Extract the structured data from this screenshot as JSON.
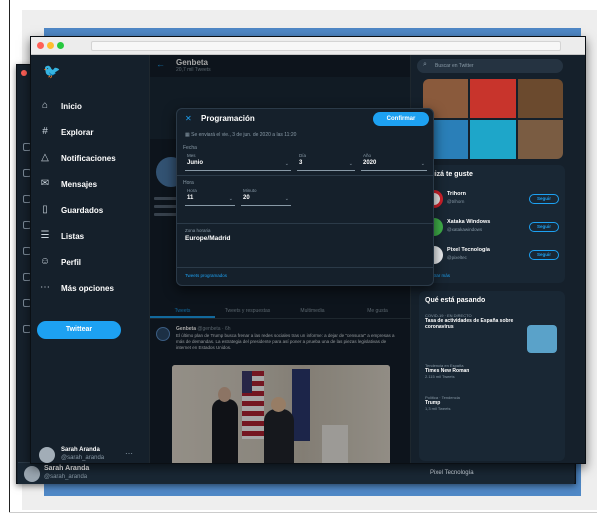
{
  "colors": {
    "accent": "#1da1f2",
    "background": "#15202b",
    "frame": "#4f88c6"
  },
  "sidebar": {
    "logo_icon": "twitter-bird-icon",
    "items": [
      {
        "label": "Inicio",
        "icon": "home-icon"
      },
      {
        "label": "Explorar",
        "icon": "hashtag-icon"
      },
      {
        "label": "Notificaciones",
        "icon": "bell-icon"
      },
      {
        "label": "Mensajes",
        "icon": "envelope-icon"
      },
      {
        "label": "Guardados",
        "icon": "bookmark-icon"
      },
      {
        "label": "Listas",
        "icon": "list-icon"
      },
      {
        "label": "Perfil",
        "icon": "person-icon"
      },
      {
        "label": "Más opciones",
        "icon": "more-icon"
      }
    ],
    "tweet_button": "Twittear",
    "account": {
      "name": "Sarah Aranda",
      "handle": "@sarah_aranda"
    }
  },
  "main": {
    "title": "Genbeta",
    "subtitle": "20,7 mil Tweets",
    "tabs": [
      "Tweets",
      "Tweets y respuestas",
      "Multimedia",
      "Me gusta"
    ],
    "tweet": {
      "author": "Genbeta",
      "meta": "@genbeta · 6h",
      "text": "El último plan de Trump busca frenar a las redes sociales tras un informe: a dejar de \"censurar\" a empresas a más de demandas. La estrategia del presidente para así poner a prueba una de las piezas legislativas de internet en Estados Unidos."
    }
  },
  "modal": {
    "title": "Programación",
    "confirm_button": "Confirmar",
    "scheduled_text": "Se enviará el vie., 3 de jun. de 2020 a las 11:20",
    "date_section": "Fecha",
    "month_label": "Mes",
    "month_value": "Junio",
    "day_label": "Día",
    "day_value": "3",
    "year_label": "Año",
    "year_value": "2020",
    "time_section": "Hora",
    "hour_label": "Hora",
    "hour_value": "11",
    "minute_label": "Minuto",
    "minute_value": "20",
    "zone_label": "Zona horaria",
    "zone_value": "Europe/Madrid",
    "footer_link": "Tweets programados"
  },
  "right": {
    "search_placeholder": "Buscar en Twitter",
    "follow_title": "Quizá te guste",
    "suggestions": [
      {
        "name": "Trihorn",
        "handle": "@trihorn",
        "button": "Seguir"
      },
      {
        "name": "Xataka Windows",
        "handle": "@xatakawindows",
        "button": "Seguir"
      },
      {
        "name": "Pixel Tecnología",
        "handle": "@pixeltec",
        "button": "Seguir"
      }
    ],
    "show_more": "Mostrar más",
    "trends_title": "Qué está pasando",
    "trends": [
      {
        "category": "COVID-19 · EN DIRECTO",
        "name": "Tasa de actividades de España sobre coronavirus",
        "count": ""
      },
      {
        "category": "Tendencia en España",
        "name": "Times New Roman",
        "count": "2.115 mil Tweets"
      },
      {
        "category": "Política · Tendencia",
        "name": "Trump",
        "count": "1,3 mil Tweets"
      }
    ],
    "back_window_account": "Pixel Tecnología"
  },
  "back_window": {
    "account_name": "Sarah Aranda",
    "account_handle": "@sarah_aranda"
  }
}
